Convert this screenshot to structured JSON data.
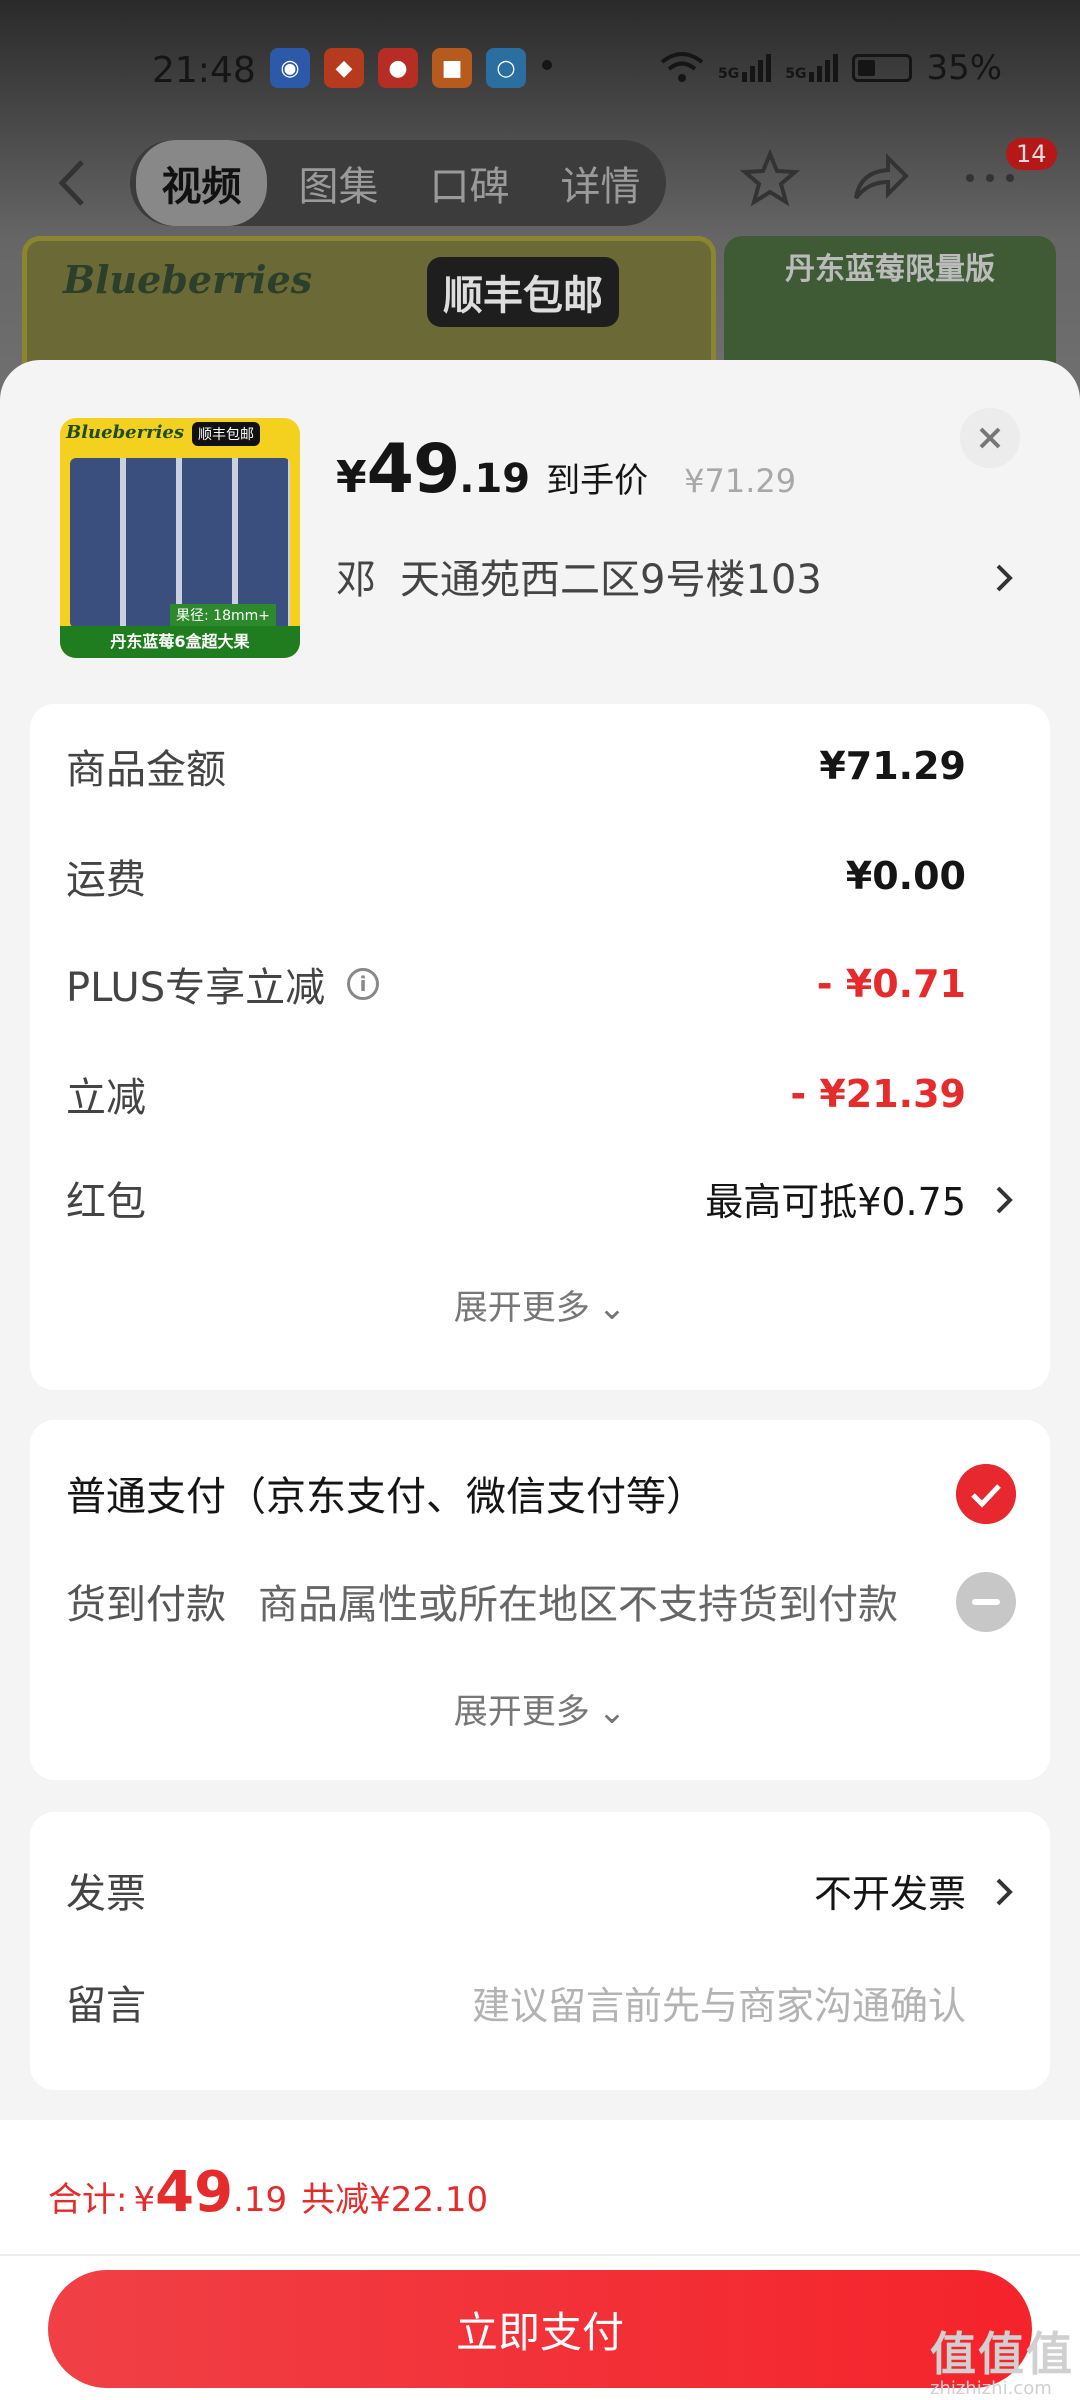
{
  "status_bar": {
    "time": "21:48",
    "battery": "35%",
    "battery_level": 0.35,
    "network_1": "5G",
    "network_2": "5G"
  },
  "background_page": {
    "tabs": [
      {
        "label": "视频",
        "active": true
      },
      {
        "label": "图集",
        "active": false
      },
      {
        "label": "口碑",
        "active": false
      },
      {
        "label": "详情",
        "active": false
      }
    ],
    "badge_count": "14",
    "banner_brand": "Blueberries",
    "banner_shipping": "顺丰包邮",
    "banner_right_title": "丹东蓝莓限量版"
  },
  "product": {
    "thumb_brand": "Blueberries",
    "thumb_shipping": "顺丰包邮",
    "thumb_spec": "果径: 18mm+",
    "thumb_label": "丹东蓝莓6盒超大果",
    "price_symbol": "¥",
    "price_int": "49",
    "price_dec": ".19",
    "price_tag": "到手价",
    "original_price": "¥71.29"
  },
  "address": {
    "name": "邓",
    "text": "天通苑西二区9号楼103"
  },
  "summary": {
    "rows": [
      {
        "label": "商品金额",
        "value": "¥71.29"
      },
      {
        "label": "运费",
        "value": "¥0.00"
      },
      {
        "label": "PLUS专享立减",
        "value": "- ¥0.71"
      },
      {
        "label": "立减",
        "value": "- ¥21.39"
      },
      {
        "label": "红包",
        "value": "最高可抵¥0.75"
      }
    ],
    "expand": "展开更多"
  },
  "payment": {
    "normal_label": "普通支付（京东支付、微信支付等）",
    "cod_label": "货到付款",
    "cod_note": "商品属性或所在地区不支持货到付款",
    "expand": "展开更多"
  },
  "extras": {
    "invoice_label": "发票",
    "invoice_value": "不开发票",
    "note_label": "留言",
    "note_placeholder": "建议留言前先与商家沟通确认"
  },
  "footer": {
    "total_label": "合计:",
    "total_symbol": "¥",
    "total_int": "49",
    "total_dec": ".19",
    "total_saved": "共减¥22.10",
    "pay_button": "立即支付"
  },
  "watermark": {
    "main": "值值值",
    "sub": "zhizhizhi.com"
  },
  "colors": {
    "accent": "#e52b2b",
    "pay_button": "#f5232b",
    "sheet_bg": "#f4f4f4"
  }
}
